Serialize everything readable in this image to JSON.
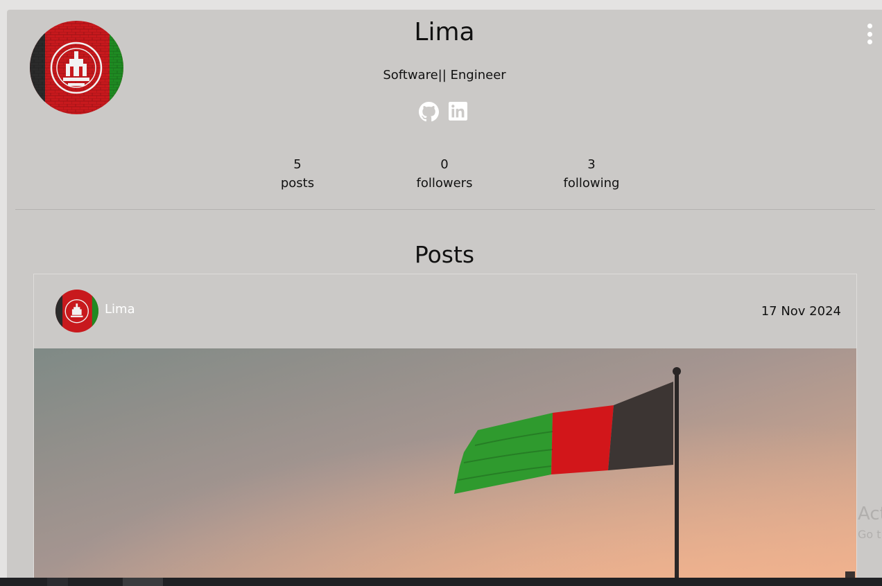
{
  "profile": {
    "name": "Lima",
    "bio": "Software|| Engineer",
    "social": [
      {
        "icon": "github-icon",
        "label": "GitHub"
      },
      {
        "icon": "linkedin-icon",
        "label": "LinkedIn"
      }
    ],
    "stats": [
      {
        "value": "5",
        "label": "posts"
      },
      {
        "value": "0",
        "label": "followers"
      },
      {
        "value": "3",
        "label": "following"
      }
    ],
    "menu_icon": "kebab-menu-icon"
  },
  "posts_section": {
    "title": "Posts",
    "posts": [
      {
        "author": "Lima",
        "date": "17 Nov 2024",
        "image": "Afghan flag on pole at sunset"
      }
    ]
  },
  "os_watermark": {
    "line1": "Act",
    "line2": "Go t"
  },
  "colors": {
    "page_bg": "#e4e3e2",
    "card_bg": "#cbc9c7",
    "flag_black": "#1f1f1f",
    "flag_red": "#c8191d",
    "flag_green": "#1f8a22"
  }
}
